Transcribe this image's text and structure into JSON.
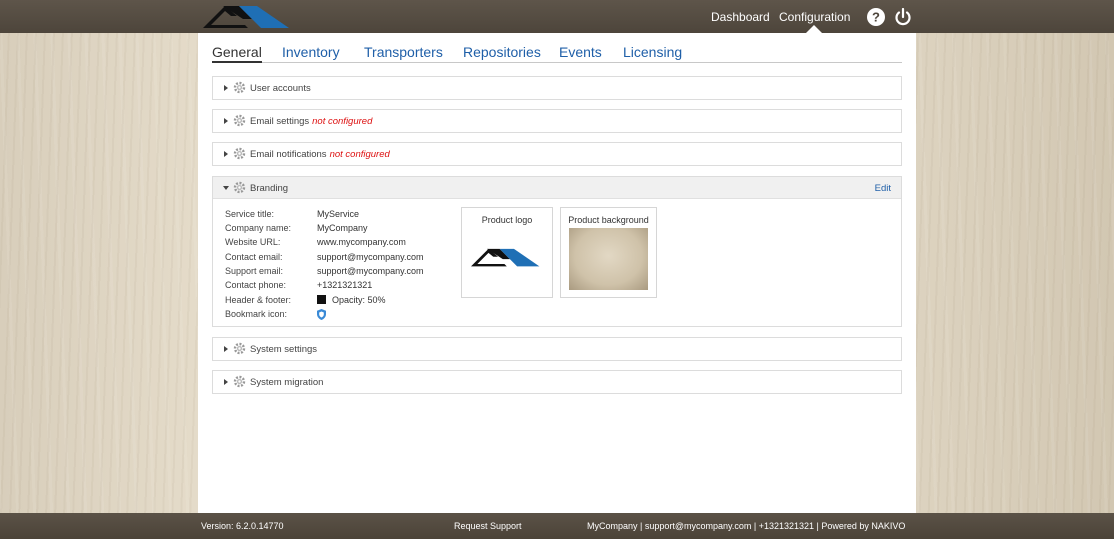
{
  "header": {
    "nav": [
      {
        "label": "Dashboard"
      },
      {
        "label": "Configuration"
      }
    ]
  },
  "tabs": [
    {
      "label": "General",
      "active": true
    },
    {
      "label": "Inventory"
    },
    {
      "label": "Transporters"
    },
    {
      "label": "Repositories"
    },
    {
      "label": "Events"
    },
    {
      "label": "Licensing"
    }
  ],
  "sections": {
    "user_accounts": {
      "title": "User accounts"
    },
    "email_settings": {
      "title": "Email settings",
      "status": "not configured"
    },
    "email_notifications": {
      "title": "Email notifications",
      "status": "not configured"
    },
    "branding": {
      "title": "Branding",
      "edit_label": "Edit",
      "fields": [
        {
          "label": "Service title:",
          "value": "MyService"
        },
        {
          "label": "Company name:",
          "value": "MyCompany"
        },
        {
          "label": "Website URL:",
          "value": "www.mycompany.com"
        },
        {
          "label": "Contact email:",
          "value": "support@mycompany.com"
        },
        {
          "label": "Support email:",
          "value": "support@mycompany.com"
        },
        {
          "label": "Contact phone:",
          "value": "+1321321321"
        },
        {
          "label": "Header & footer:",
          "value": "Opacity: 50%",
          "swatch_color": "#111111"
        },
        {
          "label": "Bookmark icon:",
          "icon": "shield-icon"
        }
      ],
      "product_logo_label": "Product logo",
      "product_background_label": "Product background"
    },
    "system_settings": {
      "title": "System settings"
    },
    "system_migration": {
      "title": "System migration"
    }
  },
  "footer": {
    "version": "Version: 6.2.0.14770",
    "request_support": "Request Support",
    "info": "MyCompany | support@mycompany.com | +1321321321 | Powered by NAKIVO"
  },
  "colors": {
    "link": "#1f5fa8",
    "status_warning": "#dd1111",
    "logo_dark": "#111111",
    "logo_blue": "#1f6fb5"
  }
}
